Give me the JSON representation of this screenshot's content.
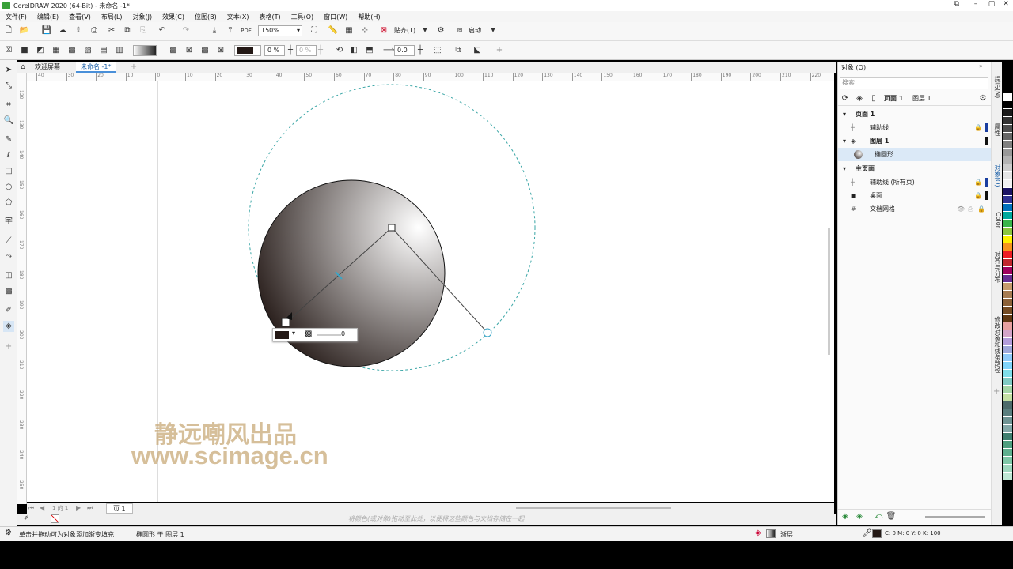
{
  "window": {
    "title": "CorelDRAW 2020 (64-Bit) - 未命名 -1*"
  },
  "menu": [
    "文件(F)",
    "编辑(E)",
    "查看(V)",
    "布局(L)",
    "对象(J)",
    "效果(C)",
    "位图(B)",
    "文本(X)",
    "表格(T)",
    "工具(O)",
    "窗口(W)",
    "帮助(H)"
  ],
  "toolbar1": {
    "zoom": "150%",
    "snap_label": "贴齐(T)",
    "launch_label": "启动"
  },
  "toolbar2": {
    "fill_opacity": "0 %",
    "opacity2": "0 %",
    "angle_value": "0.0"
  },
  "doc_tabs": [
    "欢迎屏幕",
    "未命名 -1*"
  ],
  "ruler_h": [
    "40",
    "30",
    "20",
    "10",
    "0",
    "10",
    "20",
    "30",
    "40",
    "50",
    "60",
    "70",
    "80",
    "90",
    "100",
    "110",
    "120",
    "130",
    "140",
    "150",
    "160",
    "170",
    "180",
    "190",
    "200",
    "210",
    "220",
    "230"
  ],
  "ruler_v": [
    "120",
    "130",
    "140",
    "150",
    "160",
    "170",
    "180",
    "190",
    "200",
    "210",
    "220",
    "230",
    "240",
    "250"
  ],
  "canvas": {
    "node_popup_value": "0",
    "watermark_line1": "静远嘲风出品",
    "watermark_line2": "www.scimage.cn"
  },
  "pagebar": {
    "page_counter": "1 的 1",
    "page_tab": "页 1"
  },
  "hint": "将颜色(或对象)拖动至此处，以便将这些颜色与文档存储在一起",
  "status": {
    "message": "单击并拖动可为对象添加渐变填充",
    "object_info": "椭圆形 于 图层 1",
    "fill_type": "渐层",
    "cmyk": "C: 0 M: 0 Y: 0 K: 100"
  },
  "panel": {
    "title": "对象 (O)",
    "search_placeholder": "搜索",
    "tab_page": "页面 1",
    "tab_layer": "图层 1",
    "rows": [
      {
        "label": "页面 1"
      },
      {
        "label": "辅助线"
      },
      {
        "label": "图层 1"
      },
      {
        "label": "椭圆形"
      },
      {
        "label": "主页面"
      },
      {
        "label": "辅助线 (所有页)"
      },
      {
        "label": "桌面"
      },
      {
        "label": "文档网格"
      }
    ]
  },
  "side_tabs": [
    "提示(N)",
    "属性",
    "对象(O)",
    "Color",
    "对齐与分布",
    "修改对象和线条路径"
  ],
  "colors": {
    "accent": "#1a73c8",
    "guide": "#3aa6a6",
    "selection": "#cfe4f7",
    "fill_black": "#231815"
  },
  "palette": [
    "#ffffff",
    "#000000",
    "#1a1a1a",
    "#333333",
    "#4d4d4d",
    "#666666",
    "#808080",
    "#999999",
    "#b3b3b3",
    "#cccccc",
    "#e6e6e6",
    "#f2f2f2",
    "#1b1464",
    "#2e3192",
    "#0071bc",
    "#00a99d",
    "#39b54a",
    "#8cc63f",
    "#fff200",
    "#f7941d",
    "#ed1c24",
    "#c1272d",
    "#9e005d",
    "#662d91",
    "#c69c6d",
    "#a67c52",
    "#8c6239",
    "#754c24",
    "#603813",
    "#e8a1a1",
    "#d4a5c9",
    "#b39ddb",
    "#9fa8da",
    "#90caf9",
    "#81d4fa",
    "#80deea",
    "#80cbc4",
    "#a5d6a7",
    "#c5e1a5",
    "#4d6b6b",
    "#5b7f7f",
    "#6f9494",
    "#83a8a8",
    "#3f7f6f",
    "#4f9f7f",
    "#5fb08f",
    "#7fc8a8",
    "#9fd8bf",
    "#bfe8d5"
  ]
}
